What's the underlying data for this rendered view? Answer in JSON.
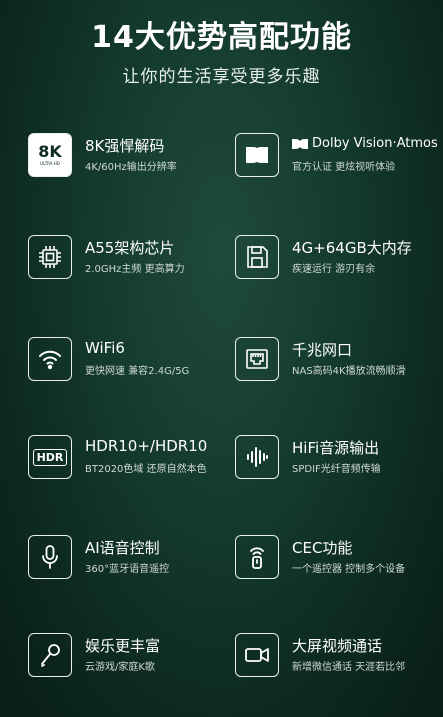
{
  "header": {
    "title": "14大优势高配功能",
    "subtitle": "让你的生活享受更多乐趣"
  },
  "features": [
    {
      "icon": "8k-icon",
      "icon_text": "8K",
      "icon_subtext": "ULTRA HD",
      "title": "8K强悍解码",
      "desc": "4K/60Hz输出分辨率"
    },
    {
      "icon": "dolby-icon",
      "title": "Dolby Vision·Atmos",
      "desc": "官方认证 更炫视听体验"
    },
    {
      "icon": "chip-icon",
      "title": "A55架构芯片",
      "desc": "2.0GHz主频 更高算力"
    },
    {
      "icon": "floppy-disk-icon",
      "title": "4G+64GB大内存",
      "desc": "疾速运行 游刃有余"
    },
    {
      "icon": "wifi-icon",
      "title": "WiFi6",
      "desc": "更快网速 兼容2.4G/5G"
    },
    {
      "icon": "ethernet-port-icon",
      "title": "千兆网口",
      "desc": "NAS高码4K播放流畅顺滑"
    },
    {
      "icon": "hdr-icon",
      "icon_text": "HDR",
      "title": "HDR10+/HDR10",
      "desc": "BT2020色域 还原自然本色"
    },
    {
      "icon": "audio-waveform-icon",
      "title": "HiFi音源输出",
      "desc": "SPDIF光纤音频传输"
    },
    {
      "icon": "microphone-icon",
      "title": "AI语音控制",
      "desc": "360°蓝牙语音遥控"
    },
    {
      "icon": "remote-control-icon",
      "title": "CEC功能",
      "desc": "一个遥控器 控制多个设备"
    },
    {
      "icon": "karaoke-mic-icon",
      "title": "娱乐更丰富",
      "desc": "云游戏/家庭K歌"
    },
    {
      "icon": "video-camera-icon",
      "title": "大屏视频通话",
      "desc": "新增微信通话 天涯若比邻"
    }
  ]
}
